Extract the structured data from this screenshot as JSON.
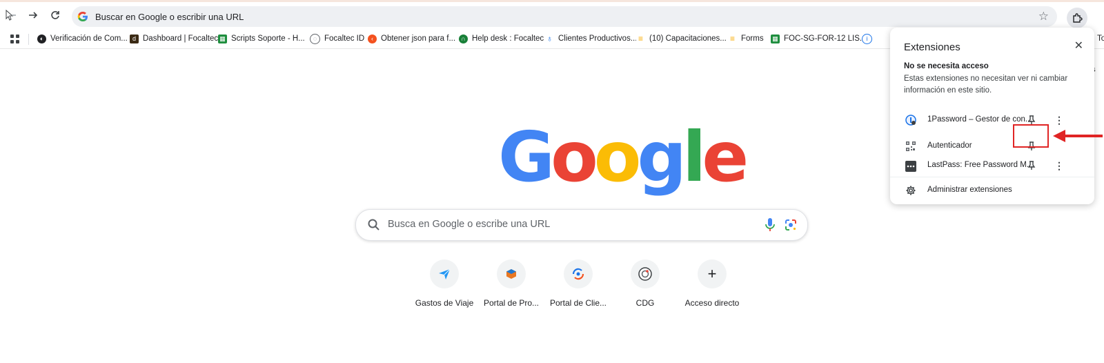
{
  "toolbar": {
    "address_text": "Buscar en Google o escribir una URL"
  },
  "bookmarks": [
    {
      "label": "Verificación de Com...",
      "icon": "globe-icon",
      "color": "#202124"
    },
    {
      "label": "Dashboard | Focaltec",
      "icon": "d-icon",
      "color": "#3b2a14"
    },
    {
      "label": "Scripts Soporte - H...",
      "icon": "sheets-icon",
      "color": "#1e8e3e"
    },
    {
      "label": "Focaltec ID",
      "icon": "focaltec-icon",
      "color": "#5f6368"
    },
    {
      "label": "Obtener json para f...",
      "icon": "orange-icon",
      "color": "#f4511e"
    },
    {
      "label": "Help desk : Focaltec",
      "icon": "helpdesk-icon",
      "color": "#188038"
    },
    {
      "label": "Clientes Productivos...",
      "icon": "drop-icon",
      "color": "#1a73e8"
    },
    {
      "label": "(10) Capacitaciones...",
      "icon": "forms-icon",
      "color": "#f9ab00"
    },
    {
      "label": "Forms",
      "icon": "forms-icon",
      "color": "#f9ab00"
    },
    {
      "label": "FOC-SG-FOR-12 LIS...",
      "icon": "sheets-icon",
      "color": "#1e8e3e"
    }
  ],
  "bookmark_overflow": "To",
  "behind_popup_text": "es",
  "logo": {
    "letters": [
      "G",
      "o",
      "o",
      "g",
      "l",
      "e"
    ],
    "colors": [
      "#4285f4",
      "#ea4335",
      "#fbbc05",
      "#4285f4",
      "#34a853",
      "#ea4335"
    ]
  },
  "search": {
    "placeholder": "Busca en Google o escribe una URL"
  },
  "shortcuts": [
    {
      "label": "Gastos de Viaje",
      "icon": "paper-plane-icon"
    },
    {
      "label": "Portal de Pro...",
      "icon": "box-icon"
    },
    {
      "label": "Portal de Clie...",
      "icon": "sync-icon"
    },
    {
      "label": "CDG",
      "icon": "cdg-icon"
    },
    {
      "label": "Acceso directo",
      "icon": "plus-icon"
    }
  ],
  "extensions_popup": {
    "title": "Extensiones",
    "section_heading": "No se necesita acceso",
    "section_description": "Estas extensiones no necesitan ver ni cambiar información en este sitio.",
    "items": [
      {
        "name": "1Password – Gestor de con...",
        "icon": "onepassword-icon"
      },
      {
        "name": "Autenticador",
        "icon": "qr-icon"
      },
      {
        "name": "LastPass: Free Password M...",
        "icon": "lastpass-icon"
      }
    ],
    "manage_label": "Administrar extensiones"
  },
  "annotation": {
    "highlight_color": "#e02424"
  }
}
